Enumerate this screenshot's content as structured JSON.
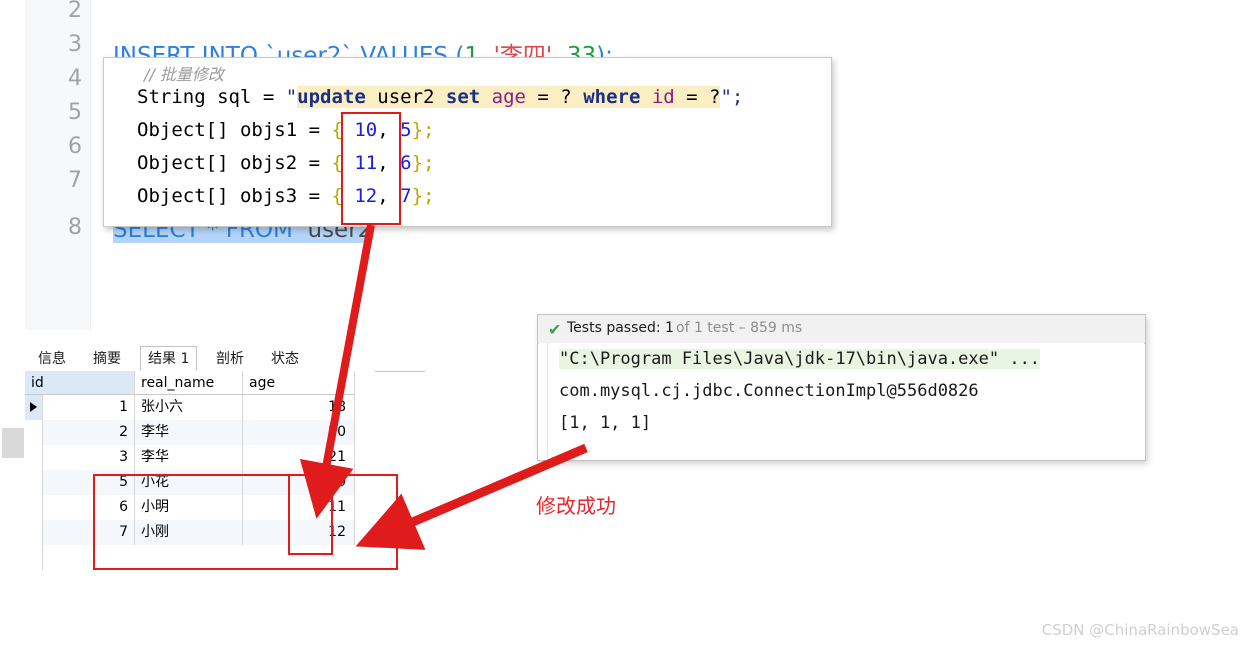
{
  "editor": {
    "line_numbers": [
      "2",
      "3",
      "4",
      "5",
      "6",
      "7",
      "8"
    ],
    "lines": [
      {
        "n": "3",
        "kw1": "INSERT INTO",
        "table": "`user2`",
        "kw2": "VALUES",
        "open": "(",
        "num1": "1",
        "comma": ", ",
        "str": "'李四'",
        "comma2": ", ",
        "num2": "33",
        "close": ");"
      },
      {
        "n": "8",
        "text": "SELECT * FROM  user2",
        "kw": "SELECT * FROM",
        "tail": "  user2",
        "selected": true
      }
    ]
  },
  "code_popup": {
    "comment": "// 批量修改",
    "decl_prefix": "String sql = ",
    "quote_open": "\"",
    "sql_update": "update",
    "sql_table": " user2 ",
    "sql_set": "set",
    "sql_age": " age ",
    "sql_eq1": "= ? ",
    "sql_where": "where",
    "sql_id": " id ",
    "sql_eq2": "= ?",
    "quote_close": "\";",
    "arrays": [
      {
        "decl": "Object[] objs1 = ",
        "lbrace": "{ ",
        "v1": "10",
        "comma": ", ",
        "v2": "5",
        "rbrace": "};"
      },
      {
        "decl": "Object[] objs2 = ",
        "lbrace": "{ ",
        "v1": "11",
        "comma": ", ",
        "v2": "6",
        "rbrace": "};"
      },
      {
        "decl": "Object[] objs3 = ",
        "lbrace": "{ ",
        "v1": "12",
        "comma": ", ",
        "v2": "7",
        "rbrace": "};"
      }
    ]
  },
  "results": {
    "tabs": [
      {
        "label": "信息",
        "active": false
      },
      {
        "label": "摘要",
        "active": false
      },
      {
        "label": "结果 1",
        "active": true
      },
      {
        "label": "剖析",
        "active": false
      },
      {
        "label": "状态",
        "active": false
      }
    ],
    "columns": [
      "id",
      "real_name",
      "age"
    ],
    "rows": [
      {
        "id": "1",
        "real_name": "张小六",
        "age": "18"
      },
      {
        "id": "2",
        "real_name": "李华",
        "age": "20"
      },
      {
        "id": "3",
        "real_name": "李华",
        "age": "21"
      },
      {
        "id": "5",
        "real_name": "小花",
        "age": "10"
      },
      {
        "id": "6",
        "real_name": "小明",
        "age": "11"
      },
      {
        "id": "7",
        "real_name": "小刚",
        "age": "12"
      }
    ]
  },
  "console": {
    "status_check": "✔",
    "status_main": "Tests passed: 1",
    "status_sub": "of 1 test – 859 ms",
    "lines": [
      "\"C:\\Program Files\\Java\\jdk-17\\bin\\java.exe\" ...",
      "com.mysql.cj.jdbc.ConnectionImpl@556d0826",
      "[1, 1, 1]"
    ]
  },
  "annotations": {
    "success_text": "修改成功",
    "accent_color": "#e01b1b"
  },
  "watermark": "CSDN @ChinaRainbowSea"
}
